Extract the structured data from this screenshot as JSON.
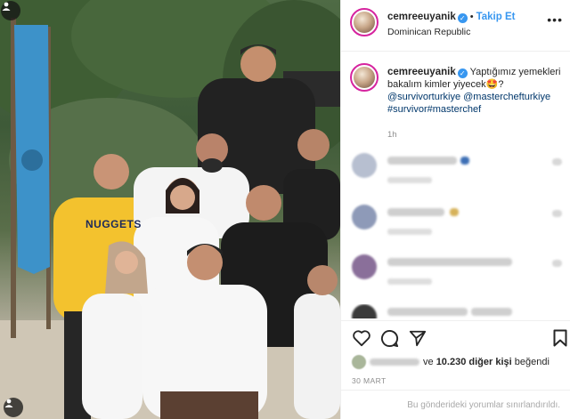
{
  "post": {
    "username": "cemreeuyanik",
    "follow_label": "Takip Et",
    "location": "Dominican Republic",
    "caption_text": "Yaptığımız yemekleri bakalım kimler yiyecek🤩?",
    "caption_tags": [
      "@survivorturkiye",
      "@masterchefturkiye",
      "#survivor#masterchef"
    ],
    "time_ago": "1h",
    "likes_suffix": "ve",
    "likes_count": "10.230 diğer kişi",
    "likes_verb": "beğendi",
    "date": "30 MART",
    "comments_restricted": "Bu gönderideki yorumlar sınırlandırıldı."
  },
  "photo": {
    "shirt_text": "NUGGETS"
  },
  "icons": {
    "more": "more-options-icon",
    "like": "heart-icon",
    "comment": "comment-icon",
    "share": "paper-plane-icon",
    "save": "bookmark-icon"
  },
  "colors": {
    "link_blue": "#3897f0",
    "tag_blue": "#00376b",
    "muted": "#8e8e8e",
    "border": "#efefef"
  }
}
